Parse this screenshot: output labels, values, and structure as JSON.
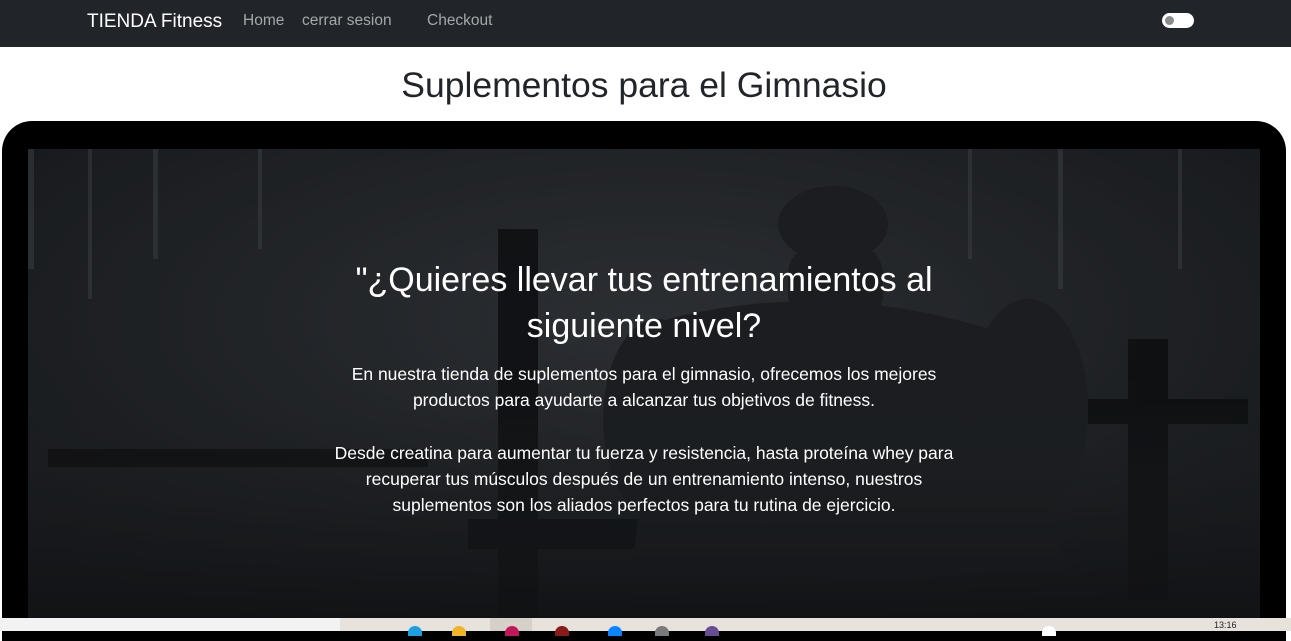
{
  "navbar": {
    "brand": "TIENDA Fitness",
    "links": [
      {
        "label": "Home"
      },
      {
        "label": "cerrar sesion"
      },
      {
        "label": "Checkout"
      }
    ],
    "theme_toggle": {
      "on": false
    }
  },
  "page": {
    "title": "Suplementos para el Gimnasio"
  },
  "hero": {
    "heading_lines": [
      "\"¿Quieres llevar tus entrenamientos al",
      "siguiente nivel?"
    ],
    "paragraph1_lines": [
      "En nuestra tienda de suplementos para el gimnasio, ofrecemos los mejores",
      "productos para ayudarte a alcanzar tus objetivos de fitness."
    ],
    "paragraph2_lines": [
      "Desde creatina para aumentar tu fuerza y resistencia, hasta proteína whey para",
      "recuperar tus músculos después de un entrenamiento intenso, nuestros",
      "suplementos son los aliados perfectos para tu rutina de ejercicio."
    ]
  },
  "taskbar": {
    "clock": "13:16"
  },
  "colors": {
    "navbar_bg": "#212529",
    "nav_link": "#a5a8ab",
    "frame": "#000000"
  }
}
